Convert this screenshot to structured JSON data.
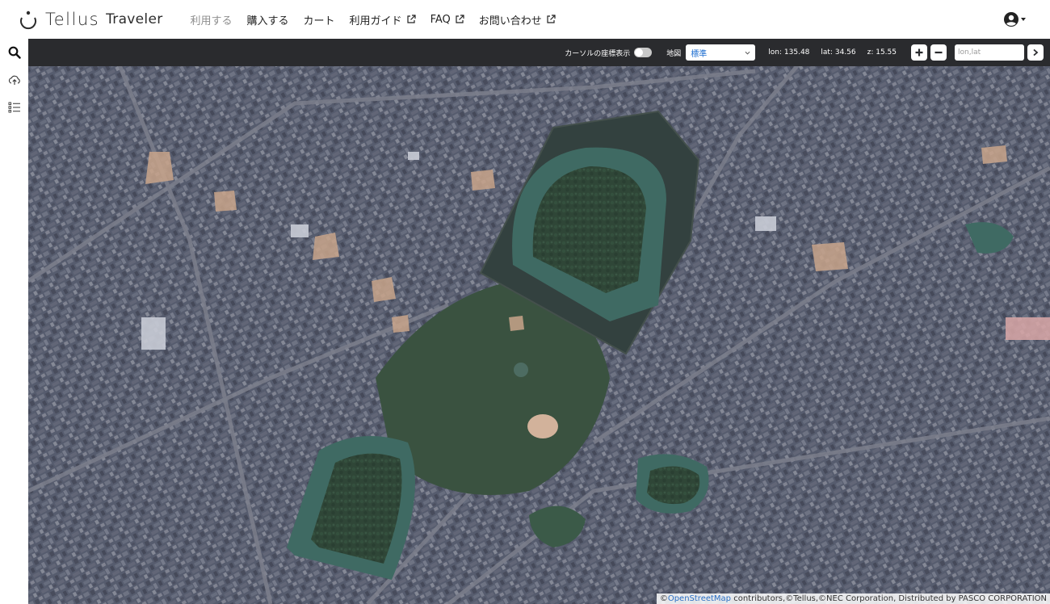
{
  "brand": {
    "name": "Tellus",
    "sub": "Traveler"
  },
  "nav": {
    "items": [
      {
        "label": "利用する",
        "external": false,
        "muted": true
      },
      {
        "label": "購入する",
        "external": false,
        "muted": false
      },
      {
        "label": "カート",
        "external": false,
        "muted": false
      },
      {
        "label": "利用ガイド",
        "external": true,
        "muted": false
      },
      {
        "label": "FAQ",
        "external": true,
        "muted": false
      },
      {
        "label": "お問い合わせ",
        "external": true,
        "muted": false
      }
    ]
  },
  "account": {
    "icon": "user-circle-icon"
  },
  "rail": {
    "icons": [
      "search-icon",
      "cloud-upload-icon",
      "list-icon"
    ]
  },
  "toolbar": {
    "cursor_coords_label": "カーソルの座標表示",
    "cursor_coords_on": false,
    "map_label": "地図",
    "map_select_value": "標準",
    "lon": "lon: 135.48",
    "lat": "lat: 34.56",
    "zoom": "z: 15.55",
    "search_placeholder": "lon,lat",
    "search_value": ""
  },
  "attribution": {
    "prefix": "©",
    "osm_link": "OpenStreetMap",
    "rest": " contributors,©Tellus,©NEC Corporation, Distributed by PASCO CORPORATION"
  },
  "colors": {
    "toolbar_bg": "#2a2b2e",
    "select_text": "#1f6fd1",
    "map_urban": "#5a5f70",
    "map_moat": "#3f6a63",
    "map_forest": "#2f4938"
  }
}
